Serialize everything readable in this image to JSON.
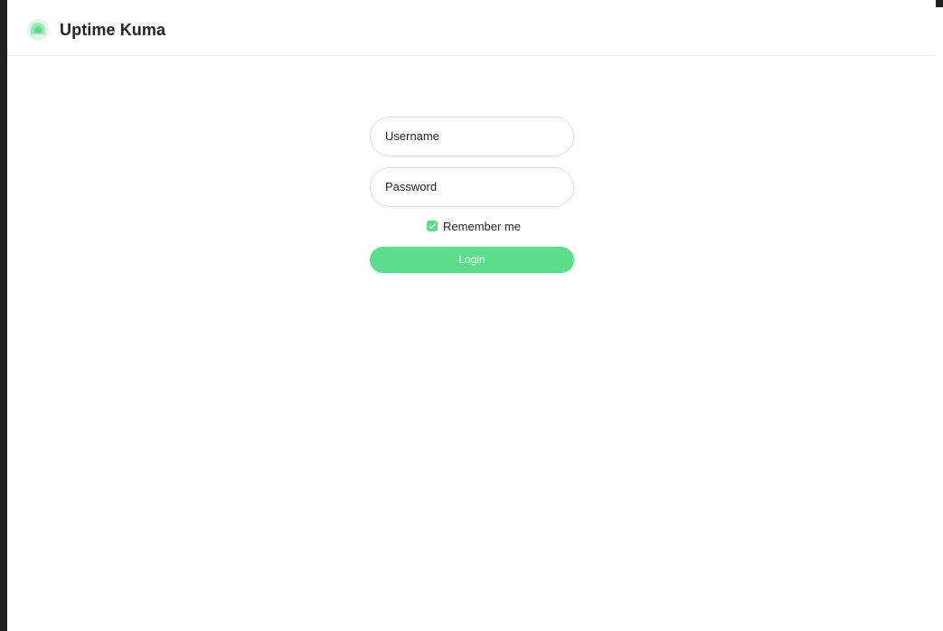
{
  "app": {
    "title": "Uptime Kuma",
    "logo_icon": "uptime-kuma-logo-icon",
    "accent_color": "#5cdd8b"
  },
  "login": {
    "username_placeholder": "Username",
    "password_placeholder": "Password",
    "remember_label": "Remember me",
    "remember_checked": true,
    "submit_label": "Login"
  }
}
